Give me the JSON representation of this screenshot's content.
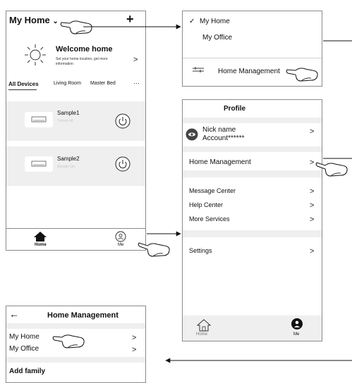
{
  "home_screen": {
    "home_selector": "My Home",
    "add_symbol": "+",
    "welcome_title": "Welcome home",
    "welcome_subtitle_1": "Set your home location, get more",
    "welcome_subtitle_2": "information",
    "tabs": [
      "All Devices",
      "Living Room",
      "Master Bed"
    ],
    "tabs_more": "···",
    "devices": [
      {
        "name": "Sample1",
        "status": "Turned off"
      },
      {
        "name": "Sample2",
        "status": "Already On"
      }
    ],
    "nav": {
      "home": "Home",
      "me": "Me"
    }
  },
  "home_menu": {
    "checkmark": "✓",
    "items": [
      "My Home",
      "My Office"
    ],
    "management": "Home Management"
  },
  "profile_screen": {
    "title": "Profile",
    "nick_name": "Nick name",
    "account": "Account******",
    "home_management": "Home Management",
    "items": [
      "Message Center",
      "Help Center",
      "More Services"
    ],
    "settings": "Settings",
    "chevron": ">",
    "nav": {
      "home": "Home",
      "me": "Me"
    }
  },
  "home_management_screen": {
    "back_arrow": "←",
    "title": "Home Management",
    "homes": [
      "My Home",
      "My  Office"
    ],
    "add_family": "Add family"
  }
}
